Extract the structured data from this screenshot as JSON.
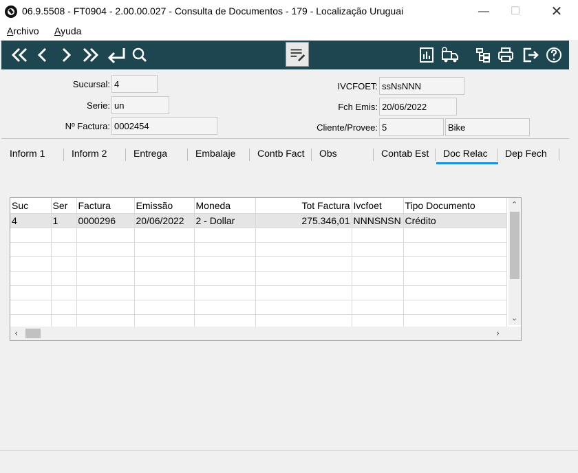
{
  "window": {
    "title": "06.9.5508 - FT0904 - 2.00.00.027 - Consulta de Documentos - 179 - Localização Uruguai"
  },
  "menu": [
    {
      "label_ul": "A",
      "label_rest": "rchivo"
    },
    {
      "label_ul": "A",
      "label_rest": "yuda"
    }
  ],
  "toolbar": {
    "icons": [
      "first-icon",
      "previous-icon",
      "next-icon",
      "last-icon",
      "return-icon",
      "search-icon",
      "edit-document-icon",
      "report-chart-icon",
      "delivery-truck-icon",
      "hierarchy-icon",
      "print-icon",
      "exit-icon",
      "help-icon"
    ]
  },
  "header": {
    "sucursal_label": "Sucursal:",
    "sucursal_value": "4",
    "serie_label": "Serie:",
    "serie_value": "un",
    "factura_label": "Nº Factura:",
    "factura_value": "0002454",
    "ivcfoet_label": "IVCFOET:",
    "ivcfoet_value": "ssNsNNN",
    "fch_label": "Fch Emis:",
    "fch_value": "20/06/2022",
    "cliente_label": "Cliente/Provee:",
    "cliente_code": "5",
    "cliente_name": "Bike"
  },
  "tabs": [
    "Inform 1",
    "Inform 2",
    "Entrega",
    "Embalaje",
    "Contb Fact",
    "Obs",
    "Contab Est",
    "Doc Relac",
    "Dep Fech"
  ],
  "active_tab": "Doc Relac",
  "grid": {
    "columns": [
      "Suc",
      "Ser",
      "Factura",
      "Emissão",
      "Moneda",
      "Tot Factura",
      "Ivcfoet",
      "Tipo Documento"
    ],
    "rows": [
      [
        "4",
        "1",
        "0000296",
        "20/06/2022",
        "2 - Dollar",
        "275.346,01",
        "NNNSNSN",
        "Crédito"
      ]
    ]
  }
}
